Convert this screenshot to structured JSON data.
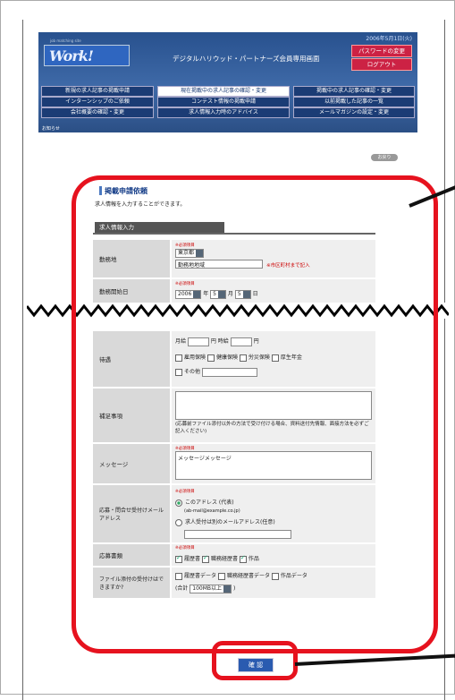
{
  "header": {
    "date": "2006年5月1日(火)",
    "logo": "Work!",
    "logo_sub": "job matching site",
    "subtitle": "デジタルハリウッド・パートナーズ会員専用画面",
    "password_button": "パスワードの変更",
    "logout_button": "ログアウト",
    "notice": "お知らせ"
  },
  "menu": [
    "新規の求人記事の掲載申請",
    "現在掲載中の求人記事の確認・変更",
    "掲載中の求人記事の確認・変更",
    "インターンシップのご依頼",
    "コンテスト情報の掲載申請",
    "以前掲載した記事の一覧",
    "会社概要の確認・変更",
    "求人情報入力時のアドバイス",
    "メールマガジンの設定・変更"
  ],
  "back_button": "お戻り",
  "page": {
    "heading": "掲載申請依頼",
    "description": "求人情報を入力することができます。",
    "tab": "求人情報入力"
  },
  "form": {
    "required": "※必須項目",
    "location_label": "勤務地",
    "location_select": "東京都",
    "location_city": "勤務地地域",
    "location_note": "※市区町村まで記入",
    "start_label": "勤務開始日",
    "start_year": "2006",
    "start_year_unit": "年",
    "start_month": "5",
    "start_month_unit": "月",
    "start_day": "5",
    "start_day_unit": "日",
    "salary_label": "待遇",
    "salary_monthly": "月給",
    "salary_yen1": "円",
    "salary_hourly": "時給",
    "salary_yen2": "円",
    "ins1": "雇用保険",
    "ins2": "健康保険",
    "ins3": "労災保険",
    "ins4": "厚生年金",
    "other": "その他",
    "notes_label": "補足事項",
    "notes_hint": "(応募前ファイル添付以外の方法で受け付ける場合、資料送付先情報、面接方法を必ずご記入ください)",
    "message_label": "メッセージ",
    "message_value": "メッセージメッセージ",
    "apply_label": "応募・問合せ受付けメールアドレス",
    "apply_opt1": "このアドレス (代表)",
    "apply_opt1_email": "(ab-mail@example.co.jp)",
    "apply_opt2": "求人受付は別のメールアドレス(任意)",
    "docs_label": "応募書類",
    "doc1": "履歴書",
    "doc2": "職務経歴書",
    "doc3": "作品",
    "attach_label": "ファイル添付の受付けはできますか?",
    "attach1": "履歴書データ",
    "attach2": "職務経歴書データ",
    "attach3": "作品データ",
    "attach_size_prefix": "(合計",
    "attach_size": "100MB以上",
    "attach_size_suffix": ")"
  },
  "submit_button": "確 認"
}
